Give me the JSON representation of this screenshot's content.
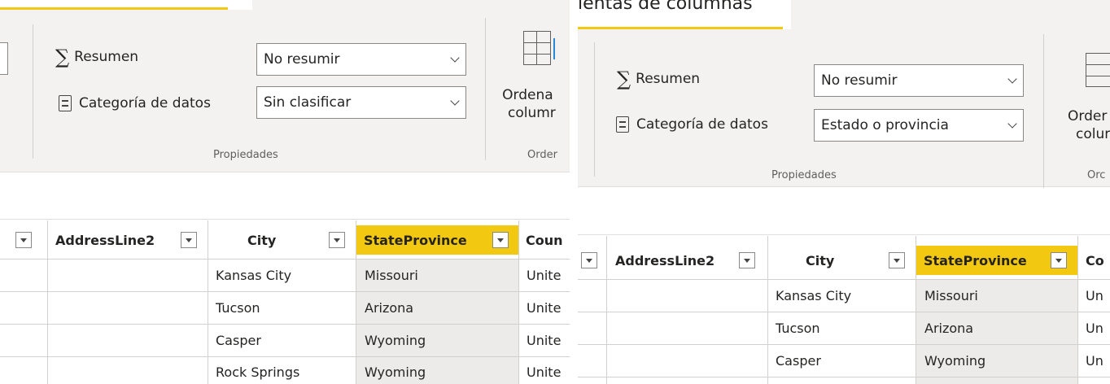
{
  "left_panel": {
    "ribbon": {
      "summary_label": "Resumen",
      "summary_value": "No resumir",
      "category_label": "Categoría de datos",
      "category_value": "Sin clasificar",
      "group_label": "Propiedades",
      "sort_label_line1": "Ordena",
      "sort_label_line2": "columr",
      "sort_group_label": "Order"
    },
    "table": {
      "headers": [
        "AddressLine2",
        "City",
        "StateProvince",
        "Coun"
      ],
      "rows": [
        {
          "address2": "",
          "city": "Kansas City",
          "state": "Missouri",
          "country": "Unite"
        },
        {
          "address2": "",
          "city": "Tucson",
          "state": "Arizona",
          "country": "Unite"
        },
        {
          "address2": "",
          "city": "Casper",
          "state": "Wyoming",
          "country": "Unite"
        },
        {
          "address2": "",
          "city": "Rock Springs",
          "state": "Wyoming",
          "country": "Unite"
        }
      ]
    }
  },
  "right_panel": {
    "ribbon": {
      "tab_title": "ientas de columnas",
      "summary_label": "Resumen",
      "summary_value": "No resumir",
      "category_label": "Categoría de datos",
      "category_value": "Estado o provincia",
      "group_label": "Propiedades",
      "sort_label_line1": "Order",
      "sort_label_line2": "colur",
      "sort_group_label": "Orc"
    },
    "table": {
      "headers": [
        "AddressLine2",
        "City",
        "StateProvince",
        "Co"
      ],
      "rows": [
        {
          "address2": "",
          "city": "Kansas City",
          "state": "Missouri",
          "country": "Un"
        },
        {
          "address2": "",
          "city": "Tucson",
          "state": "Arizona",
          "country": "Un"
        },
        {
          "address2": "",
          "city": "Casper",
          "state": "Wyoming",
          "country": "Un"
        }
      ]
    }
  },
  "icons": {
    "summary": "sigma-icon",
    "category": "data-category-icon",
    "sort": "sort-by-column-icon",
    "filter": "filter-dropdown-icon",
    "dropdown": "chevron-down-icon"
  },
  "colors": {
    "accent": "#f2c811",
    "ribbon_bg": "#f3f2f1",
    "selected_column_bg": "#ecebea"
  }
}
